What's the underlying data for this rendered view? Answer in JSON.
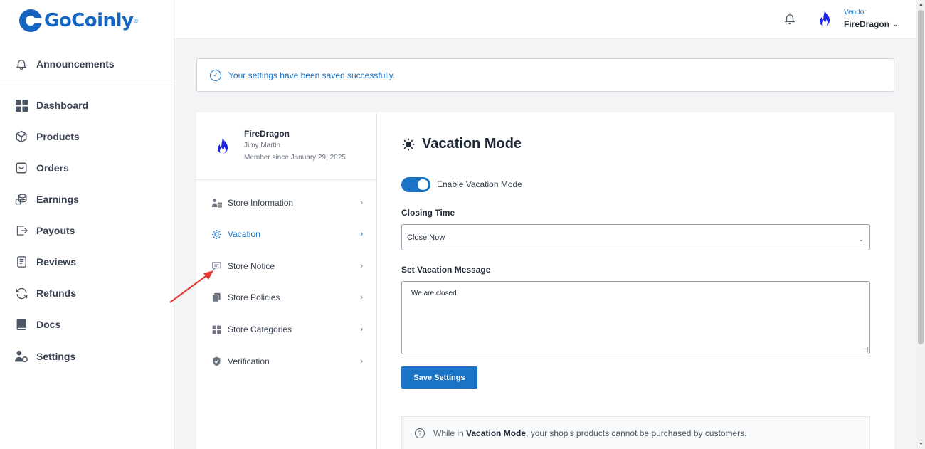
{
  "brand": {
    "name": "GoCoinly",
    "reg": "®",
    "color": "#1565c0"
  },
  "sidebar": {
    "items": [
      {
        "label": "Announcements",
        "icon": "bell-icon"
      },
      {
        "label": "Dashboard",
        "icon": "dashboard-grid-icon"
      },
      {
        "label": "Products",
        "icon": "box-icon"
      },
      {
        "label": "Orders",
        "icon": "orders-icon"
      },
      {
        "label": "Earnings",
        "icon": "coins-icon"
      },
      {
        "label": "Payouts",
        "icon": "payout-arrow-icon"
      },
      {
        "label": "Reviews",
        "icon": "clipboard-icon"
      },
      {
        "label": "Refunds",
        "icon": "refresh-icon"
      },
      {
        "label": "Docs",
        "icon": "book-icon"
      },
      {
        "label": "Settings",
        "icon": "user-settings-icon"
      }
    ]
  },
  "header": {
    "role": "Vendor",
    "username": "FireDragon",
    "chevron": "⌄"
  },
  "alert": {
    "message": "Your settings have been saved successfully.",
    "icon": "check-circle-icon"
  },
  "profile": {
    "store_name": "FireDragon",
    "full_name": "Jimy Martin",
    "member_since": "Member since January 29, 2025."
  },
  "settings_menu": [
    {
      "label": "Store Information",
      "icon": "store-info-icon",
      "active": false
    },
    {
      "label": "Vacation",
      "icon": "sun-icon",
      "active": true
    },
    {
      "label": "Store Notice",
      "icon": "message-icon",
      "active": false
    },
    {
      "label": "Store Policies",
      "icon": "documents-icon",
      "active": false
    },
    {
      "label": "Store Categories",
      "icon": "grid-icon",
      "active": false
    },
    {
      "label": "Verification",
      "icon": "shield-icon",
      "active": false
    }
  ],
  "vacation": {
    "title": "Vacation Mode",
    "toggle_label": "Enable Vacation Mode",
    "toggle_on": true,
    "closing_time_label": "Closing Time",
    "closing_time_value": "Close Now",
    "message_label": "Set Vacation Message",
    "message_value": "We are closed",
    "save_label": "Save Settings",
    "info_prefix": "While in ",
    "info_bold": "Vacation Mode",
    "info_suffix": ", your shop's products cannot be purchased by customers."
  },
  "colors": {
    "accent": "#1a73c5",
    "annotation": "#e53935"
  }
}
